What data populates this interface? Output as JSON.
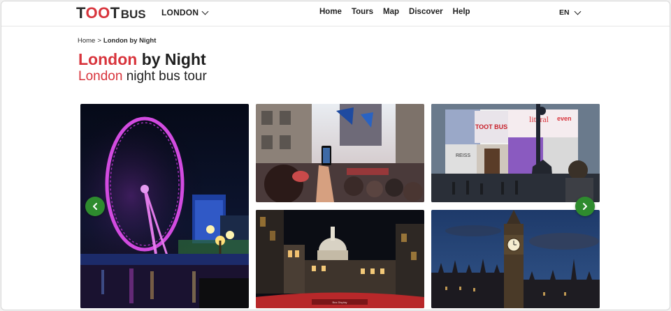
{
  "brand": {
    "logo_t": "T",
    "logo_oo": "OO",
    "logo_t2": "T",
    "logo_sub": "BUS"
  },
  "header": {
    "city": "LONDON",
    "nav": [
      "Home",
      "Tours",
      "Map",
      "Discover",
      "Help"
    ],
    "language": "EN"
  },
  "breadcrumb": {
    "home": "Home",
    "separator": ">",
    "current": "London by Night"
  },
  "title": {
    "accent": "London",
    "rest": "by Night"
  },
  "subtitle": {
    "accent": "London",
    "rest": "night bus tour"
  },
  "gallery": {
    "images": [
      {
        "subject": "london-eye-night"
      },
      {
        "subject": "crowd-filming-street"
      },
      {
        "subject": "piccadilly-circus-billboards",
        "signs": [
          "TOOT BUS",
          "REISS",
          "literal",
          "even"
        ]
      },
      {
        "subject": "st-pauls-cathedral-night",
        "bus_sign": "Bus Display"
      },
      {
        "subject": "big-ben-dusk"
      }
    ]
  },
  "colors": {
    "accent": "#d8343c",
    "arrow": "#2e8b2e"
  }
}
